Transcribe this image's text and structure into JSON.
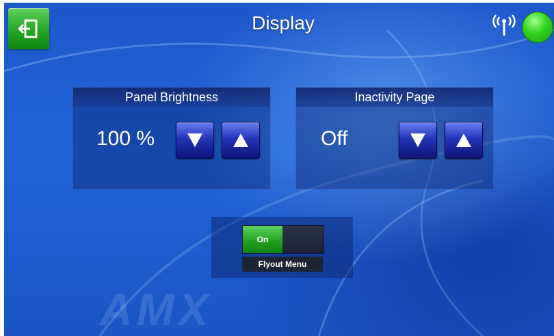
{
  "header": {
    "title": "Display",
    "back_icon": "exit-door-icon",
    "signal_icon": "wireless-signal-icon",
    "status_color": "#34d21f"
  },
  "panels": [
    {
      "title": "Panel Brightness",
      "value": "100 %",
      "down_icon": "arrow-down-icon",
      "up_icon": "arrow-up-icon"
    },
    {
      "title": "Inactivity Page",
      "value": "Off",
      "down_icon": "arrow-down-icon",
      "up_icon": "arrow-up-icon"
    }
  ],
  "flyout": {
    "toggle_on_label": "On",
    "toggle_state": "on",
    "label": "Flyout Menu"
  },
  "branding": {
    "watermark": "AMX"
  },
  "colors": {
    "accent_green": "#23a623",
    "button_blue": "#2334b8",
    "background_blue": "#1f63d6"
  }
}
